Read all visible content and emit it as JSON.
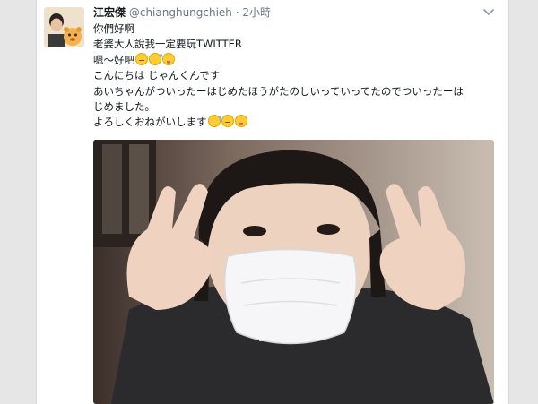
{
  "tweet": {
    "display_name": "江宏傑",
    "handle": "@chianghungchieh",
    "separator": "·",
    "timestamp": "2小時",
    "more_icon": "chevron-down-icon",
    "lines": [
      {
        "text": "你們好啊",
        "emoji": []
      },
      {
        "text": "老婆大人說我一定要玩TWITTER",
        "emoji": []
      },
      {
        "text": "嗯～好吧",
        "emoji": [
          "neutral",
          "sweat",
          "tongue"
        ]
      },
      {
        "text": "こんにちは じゃんくんです",
        "emoji": []
      },
      {
        "text": "あいちゃんがついったーはじめたほうがたのしいっていってたのでついったーは",
        "emoji": []
      },
      {
        "text": "じめました。",
        "emoji": []
      },
      {
        "text": "よろしくおねがいします",
        "emoji": [
          "sweat",
          "neutral",
          "tongue"
        ]
      }
    ]
  },
  "colors": {
    "name": "#14171a",
    "secondary": "#657786",
    "background": "#e6e6e6"
  }
}
